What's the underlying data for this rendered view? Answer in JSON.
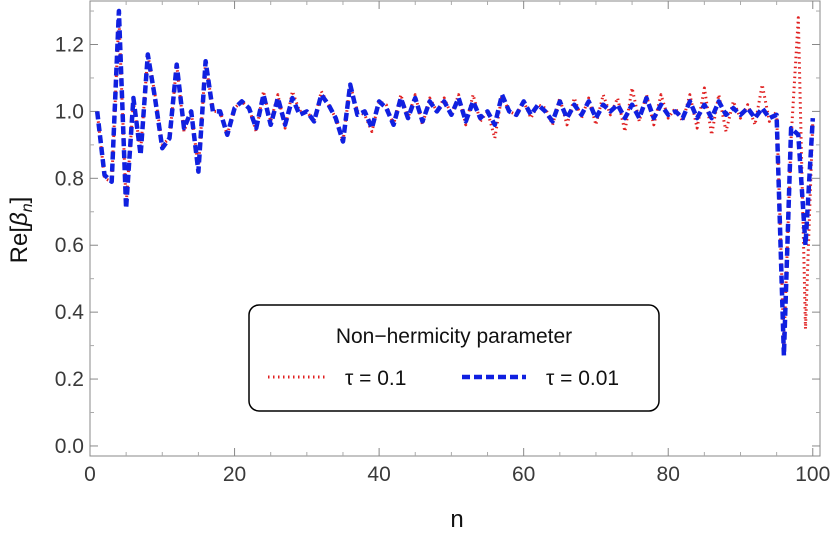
{
  "chart_data": {
    "type": "line",
    "xlabel": "n",
    "ylabel_main": "Re",
    "ylabel_symbol": "β",
    "ylabel_sub": "n",
    "xlim": [
      0,
      101
    ],
    "ylim": [
      -0.03,
      1.33
    ],
    "xticks": [
      0,
      20,
      40,
      60,
      80,
      100
    ],
    "yticks": [
      0.0,
      0.2,
      0.4,
      0.6,
      0.8,
      1.0,
      1.2
    ],
    "ytick_labels": [
      "0.0",
      "0.2",
      "0.4",
      "0.6",
      "0.8",
      "1.0",
      "1.2"
    ],
    "grid": false,
    "legend": {
      "title": "Non−hermicity parameter",
      "placement": "bottom-center",
      "entries": [
        "τ = 0.1",
        "τ = 0.01"
      ]
    },
    "series": [
      {
        "name": "τ = 0.1",
        "color": "#e02020",
        "style": "dotted",
        "x": [
          1,
          2,
          3,
          4,
          5,
          6,
          7,
          8,
          9,
          10,
          11,
          12,
          13,
          14,
          15,
          16,
          17,
          18,
          19,
          20,
          21,
          22,
          23,
          24,
          25,
          26,
          27,
          28,
          29,
          30,
          31,
          32,
          33,
          34,
          35,
          36,
          37,
          38,
          39,
          40,
          41,
          42,
          43,
          44,
          45,
          46,
          47,
          48,
          49,
          50,
          51,
          52,
          53,
          54,
          55,
          56,
          57,
          58,
          59,
          60,
          61,
          62,
          63,
          64,
          65,
          66,
          67,
          68,
          69,
          70,
          71,
          72,
          73,
          74,
          75,
          76,
          77,
          78,
          79,
          80,
          81,
          82,
          83,
          84,
          85,
          86,
          87,
          88,
          89,
          90,
          91,
          92,
          93,
          94,
          95,
          96,
          97,
          98,
          99,
          100
        ],
        "y": [
          1.0,
          0.8,
          0.79,
          1.28,
          0.72,
          1.03,
          0.88,
          1.17,
          1.05,
          0.9,
          0.92,
          1.14,
          0.94,
          1.0,
          0.83,
          1.15,
          1.0,
          1.0,
          0.93,
          1.01,
          1.03,
          1.01,
          0.94,
          1.06,
          0.97,
          1.05,
          0.95,
          1.06,
          1.0,
          1.0,
          0.97,
          1.06,
          1.02,
          0.98,
          0.91,
          1.08,
          1.0,
          0.99,
          0.94,
          1.03,
          1.02,
          0.96,
          1.05,
          0.98,
          1.05,
          0.96,
          1.04,
          1.0,
          1.04,
          0.99,
          1.05,
          0.96,
          1.05,
          0.97,
          1.0,
          0.92,
          1.05,
          1.0,
          0.99,
          1.03,
          0.98,
          1.02,
          1.01,
          0.96,
          1.04,
          0.96,
          1.04,
          0.98,
          1.04,
          0.96,
          1.05,
          0.99,
          1.04,
          0.94,
          1.07,
          0.97,
          1.05,
          0.96,
          1.05,
          0.98,
          1.01,
          0.97,
          1.05,
          0.95,
          1.07,
          0.93,
          1.05,
          0.94,
          1.03,
          0.98,
          1.02,
          0.96,
          1.08,
          0.97,
          1.0,
          0.3,
          0.92,
          1.28,
          0.35,
          0.97
        ]
      },
      {
        "name": "τ = 0.01",
        "color": "#1020e0",
        "style": "dashed",
        "x": [
          1,
          2,
          3,
          4,
          5,
          6,
          7,
          8,
          9,
          10,
          11,
          12,
          13,
          14,
          15,
          16,
          17,
          18,
          19,
          20,
          21,
          22,
          23,
          24,
          25,
          26,
          27,
          28,
          29,
          30,
          31,
          32,
          33,
          34,
          35,
          36,
          37,
          38,
          39,
          40,
          41,
          42,
          43,
          44,
          45,
          46,
          47,
          48,
          49,
          50,
          51,
          52,
          53,
          54,
          55,
          56,
          57,
          58,
          59,
          60,
          61,
          62,
          63,
          64,
          65,
          66,
          67,
          68,
          69,
          70,
          71,
          72,
          73,
          74,
          75,
          76,
          77,
          78,
          79,
          80,
          81,
          82,
          83,
          84,
          85,
          86,
          87,
          88,
          89,
          90,
          91,
          92,
          93,
          94,
          95,
          96,
          97,
          98,
          99,
          100
        ],
        "y": [
          1.0,
          0.81,
          0.79,
          1.3,
          0.71,
          1.04,
          0.87,
          1.17,
          1.04,
          0.89,
          0.92,
          1.14,
          0.95,
          1.0,
          0.82,
          1.15,
          1.0,
          1.0,
          0.93,
          1.01,
          1.03,
          1.01,
          0.95,
          1.05,
          0.96,
          1.04,
          0.96,
          1.04,
          0.99,
          1.0,
          0.97,
          1.05,
          1.02,
          0.98,
          0.91,
          1.08,
          0.99,
          1.0,
          0.95,
          1.03,
          1.01,
          0.96,
          1.04,
          0.98,
          1.04,
          0.97,
          1.03,
          1.0,
          1.03,
          0.99,
          1.04,
          0.97,
          1.03,
          0.98,
          1.0,
          0.96,
          1.05,
          1.0,
          0.99,
          1.03,
          0.99,
          1.02,
          1.0,
          0.97,
          1.03,
          0.98,
          1.02,
          0.99,
          1.03,
          0.98,
          1.02,
          1.0,
          1.02,
          0.98,
          1.02,
          0.98,
          1.04,
          0.98,
          1.02,
          0.99,
          1.0,
          0.98,
          1.03,
          0.98,
          1.02,
          0.98,
          1.03,
          0.99,
          1.01,
          0.99,
          1.01,
          0.98,
          1.01,
          0.98,
          0.99,
          0.27,
          0.95,
          0.93,
          0.6,
          0.98
        ]
      }
    ]
  }
}
